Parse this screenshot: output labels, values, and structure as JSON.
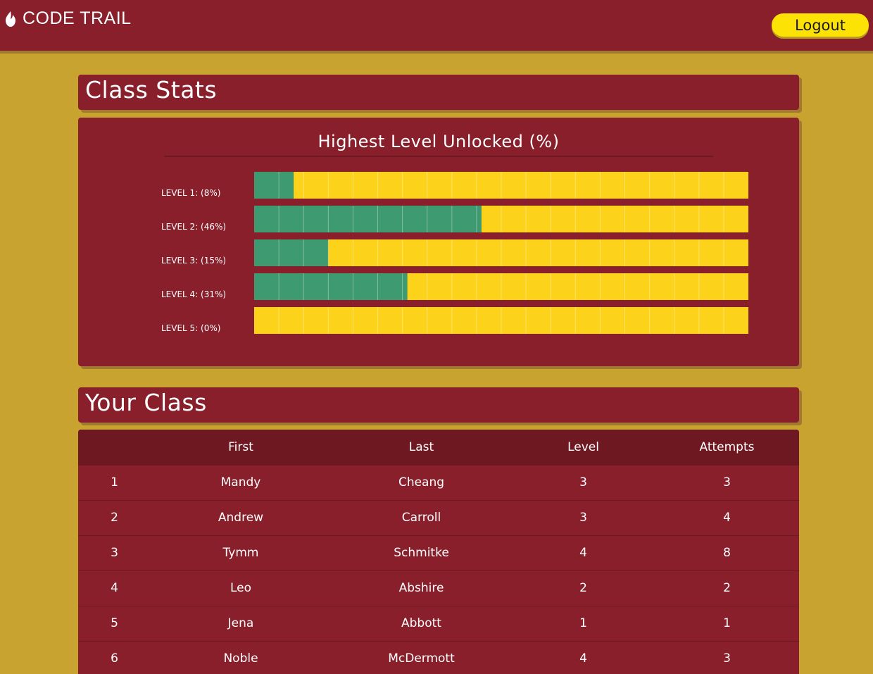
{
  "app": {
    "brand": "CODE TRAIL",
    "logout_label": "Logout"
  },
  "stats_section": {
    "title": "Class Stats"
  },
  "class_section": {
    "title": "Your Class"
  },
  "colors": {
    "background": "#C9A32F",
    "panel": "#891F2B",
    "panel_dark": "#6E1822",
    "bar_track": "#FCD21B",
    "bar_fill": "#3E9A70",
    "button": "#FCE305"
  },
  "chart_data": {
    "type": "bar",
    "orientation": "horizontal",
    "title": "Highest Level Unlocked (%)",
    "categories": [
      "LEVEL 1: (8%)",
      "LEVEL 2: (46%)",
      "LEVEL 3: (15%)",
      "LEVEL 4: (31%)",
      "LEVEL 5: (0%)"
    ],
    "values": [
      8,
      46,
      15,
      31,
      0
    ],
    "xlim": [
      0,
      100
    ],
    "grid": true
  },
  "table": {
    "headers": [
      "",
      "First",
      "Last",
      "Level",
      "Attempts"
    ],
    "rows": [
      [
        "1",
        "Mandy",
        "Cheang",
        "3",
        "3"
      ],
      [
        "2",
        "Andrew",
        "Carroll",
        "3",
        "4"
      ],
      [
        "3",
        "Tymm",
        "Schmitke",
        "4",
        "8"
      ],
      [
        "4",
        "Leo",
        "Abshire",
        "2",
        "2"
      ],
      [
        "5",
        "Jena",
        "Abbott",
        "1",
        "1"
      ],
      [
        "6",
        "Noble",
        "McDermott",
        "4",
        "3"
      ]
    ]
  }
}
